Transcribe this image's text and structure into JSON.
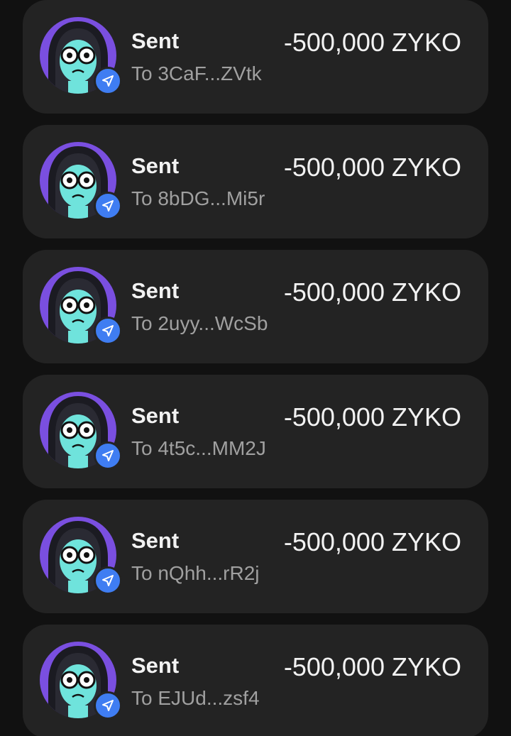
{
  "colors": {
    "background": "#111111",
    "card": "#232323",
    "avatar_bg": "#7a4fe0",
    "badge": "#3f7df2",
    "title": "#f2f2f2",
    "subtitle": "#a0a0a0"
  },
  "transactions": [
    {
      "type_label": "Sent",
      "recipient": "To 3CaF...ZVtk",
      "amount": "-500,000 ZYKO",
      "badge_icon": "send-icon"
    },
    {
      "type_label": "Sent",
      "recipient": "To 8bDG...Mi5r",
      "amount": "-500,000 ZYKO",
      "badge_icon": "send-icon"
    },
    {
      "type_label": "Sent",
      "recipient": "To 2uyy...WcSb",
      "amount": "-500,000 ZYKO",
      "badge_icon": "send-icon"
    },
    {
      "type_label": "Sent",
      "recipient": "To 4t5c...MM2J",
      "amount": "-500,000 ZYKO",
      "badge_icon": "send-icon"
    },
    {
      "type_label": "Sent",
      "recipient": "To nQhh...rR2j",
      "amount": "-500,000 ZYKO",
      "badge_icon": "send-icon"
    },
    {
      "type_label": "Sent",
      "recipient": "To EJUd...zsf4",
      "amount": "-500,000 ZYKO",
      "badge_icon": "send-icon"
    }
  ]
}
